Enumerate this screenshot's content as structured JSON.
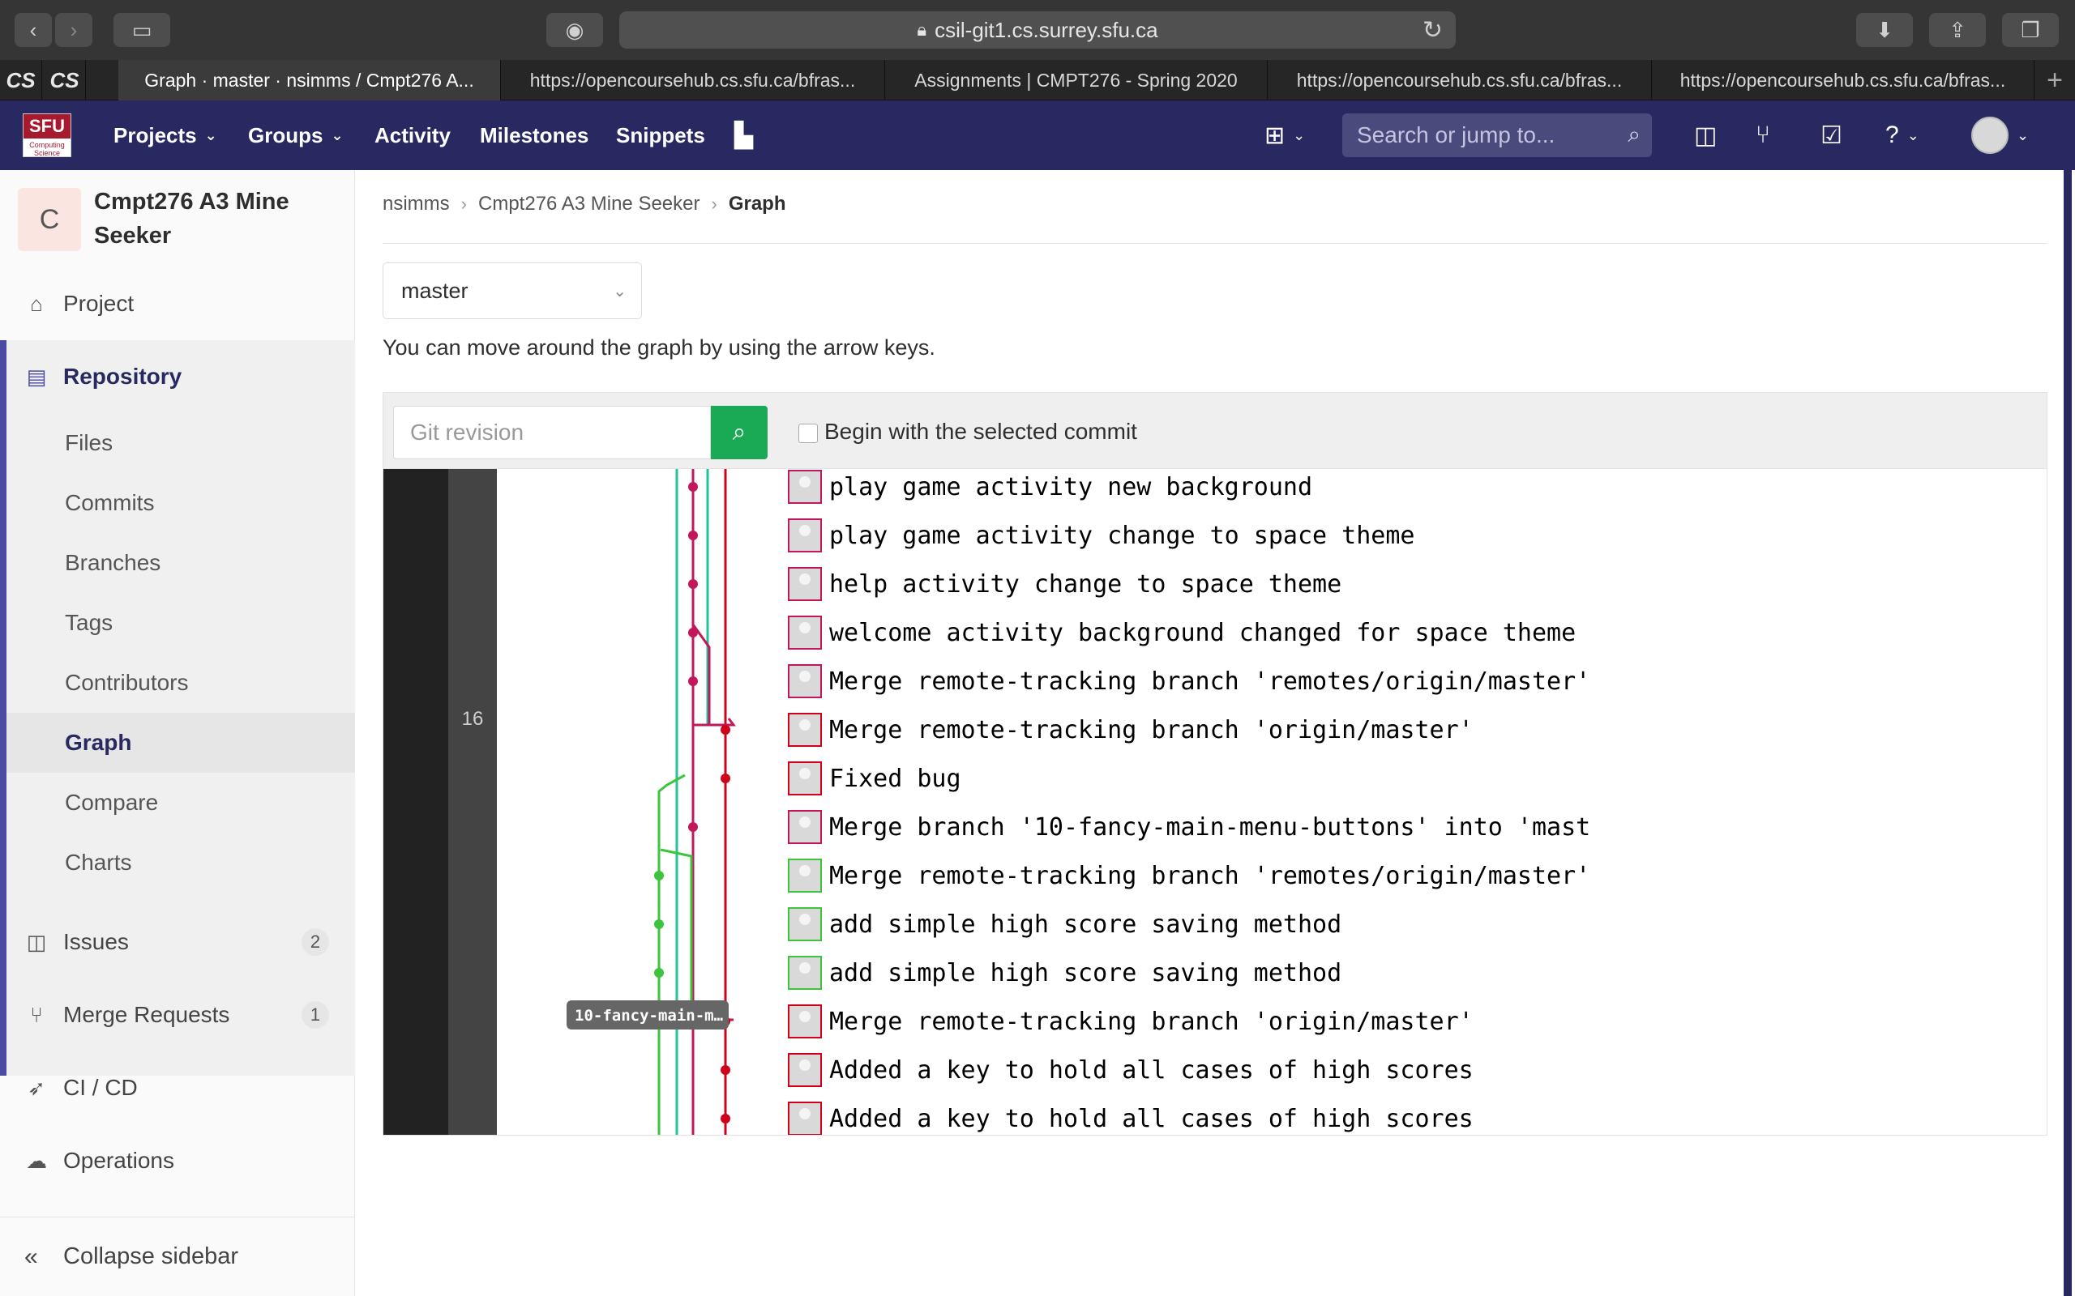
{
  "browser": {
    "url": "csil-git1.cs.surrey.sfu.ca",
    "tabs": [
      {
        "label": "Graph · master · nsimms / Cmpt276 A..."
      },
      {
        "label": "https://opencoursehub.cs.sfu.ca/bfras..."
      },
      {
        "label": "Assignments | CMPT276 - Spring 2020"
      },
      {
        "label": "https://opencoursehub.cs.sfu.ca/bfras..."
      },
      {
        "label": "https://opencoursehub.cs.sfu.ca/bfras..."
      }
    ],
    "favicons": [
      "CS",
      "CS"
    ]
  },
  "navbar": {
    "logo_top": "SFU",
    "logo_bottom": "Computing Science",
    "items": [
      "Projects",
      "Groups",
      "Activity",
      "Milestones",
      "Snippets"
    ],
    "search_placeholder": "Search or jump to..."
  },
  "sidebar": {
    "project_initial": "C",
    "project_name": "Cmpt276 A3 Mine Seeker",
    "project_link": "Project",
    "repository": "Repository",
    "repo_items": [
      "Files",
      "Commits",
      "Branches",
      "Tags",
      "Contributors",
      "Graph",
      "Compare",
      "Charts"
    ],
    "active_item": "Graph",
    "issues": {
      "label": "Issues",
      "count": "2"
    },
    "merge_requests": {
      "label": "Merge Requests",
      "count": "1"
    },
    "cicd": "CI / CD",
    "operations": "Operations",
    "collapse": "Collapse sidebar"
  },
  "content": {
    "breadcrumb": [
      "nsimms",
      "Cmpt276 A3 Mine Seeker",
      "Graph"
    ],
    "branch": "master",
    "hint": "You can move around the graph by using the arrow keys.",
    "revision_placeholder": "Git revision",
    "begin_label": "Begin with the selected commit",
    "day_label": "16",
    "branch_label": "10-fancy-main-m…",
    "commits": [
      {
        "message": "play game activity new background",
        "color": "#c2185b"
      },
      {
        "message": "play game activity change to space theme",
        "color": "#c2185b"
      },
      {
        "message": "help activity change to space theme",
        "color": "#c2185b"
      },
      {
        "message": "welcome activity background changed for space theme",
        "color": "#c2185b"
      },
      {
        "message": "Merge remote-tracking branch 'remotes/origin/master'",
        "color": "#c2185b"
      },
      {
        "message": "Merge remote-tracking branch 'origin/master'",
        "color": "#d0021b"
      },
      {
        "message": "Fixed bug",
        "color": "#d0021b"
      },
      {
        "message": "Merge branch '10-fancy-main-menu-buttons' into 'mast",
        "color": "#c2185b"
      },
      {
        "message": "Merge remote-tracking branch 'remotes/origin/master'",
        "color": "#3cc43c"
      },
      {
        "message": "add simple high score saving method",
        "color": "#3cc43c"
      },
      {
        "message": "add simple high score saving method",
        "color": "#3cc43c"
      },
      {
        "message": "Merge remote-tracking branch 'origin/master'",
        "color": "#d0021b"
      },
      {
        "message": "Added a key to hold all cases of high scores",
        "color": "#d0021b"
      },
      {
        "message": "Added a key to hold all cases of high scores",
        "color": "#d0021b"
      }
    ]
  },
  "colors": {
    "navbar": "#292961",
    "accent": "#4b4ba3",
    "search_button": "#1aaa55",
    "lane_green": "#3cc43c",
    "lane_teal": "#1fc49a",
    "lane_magenta": "#c2185b",
    "lane_red": "#d0021b"
  }
}
